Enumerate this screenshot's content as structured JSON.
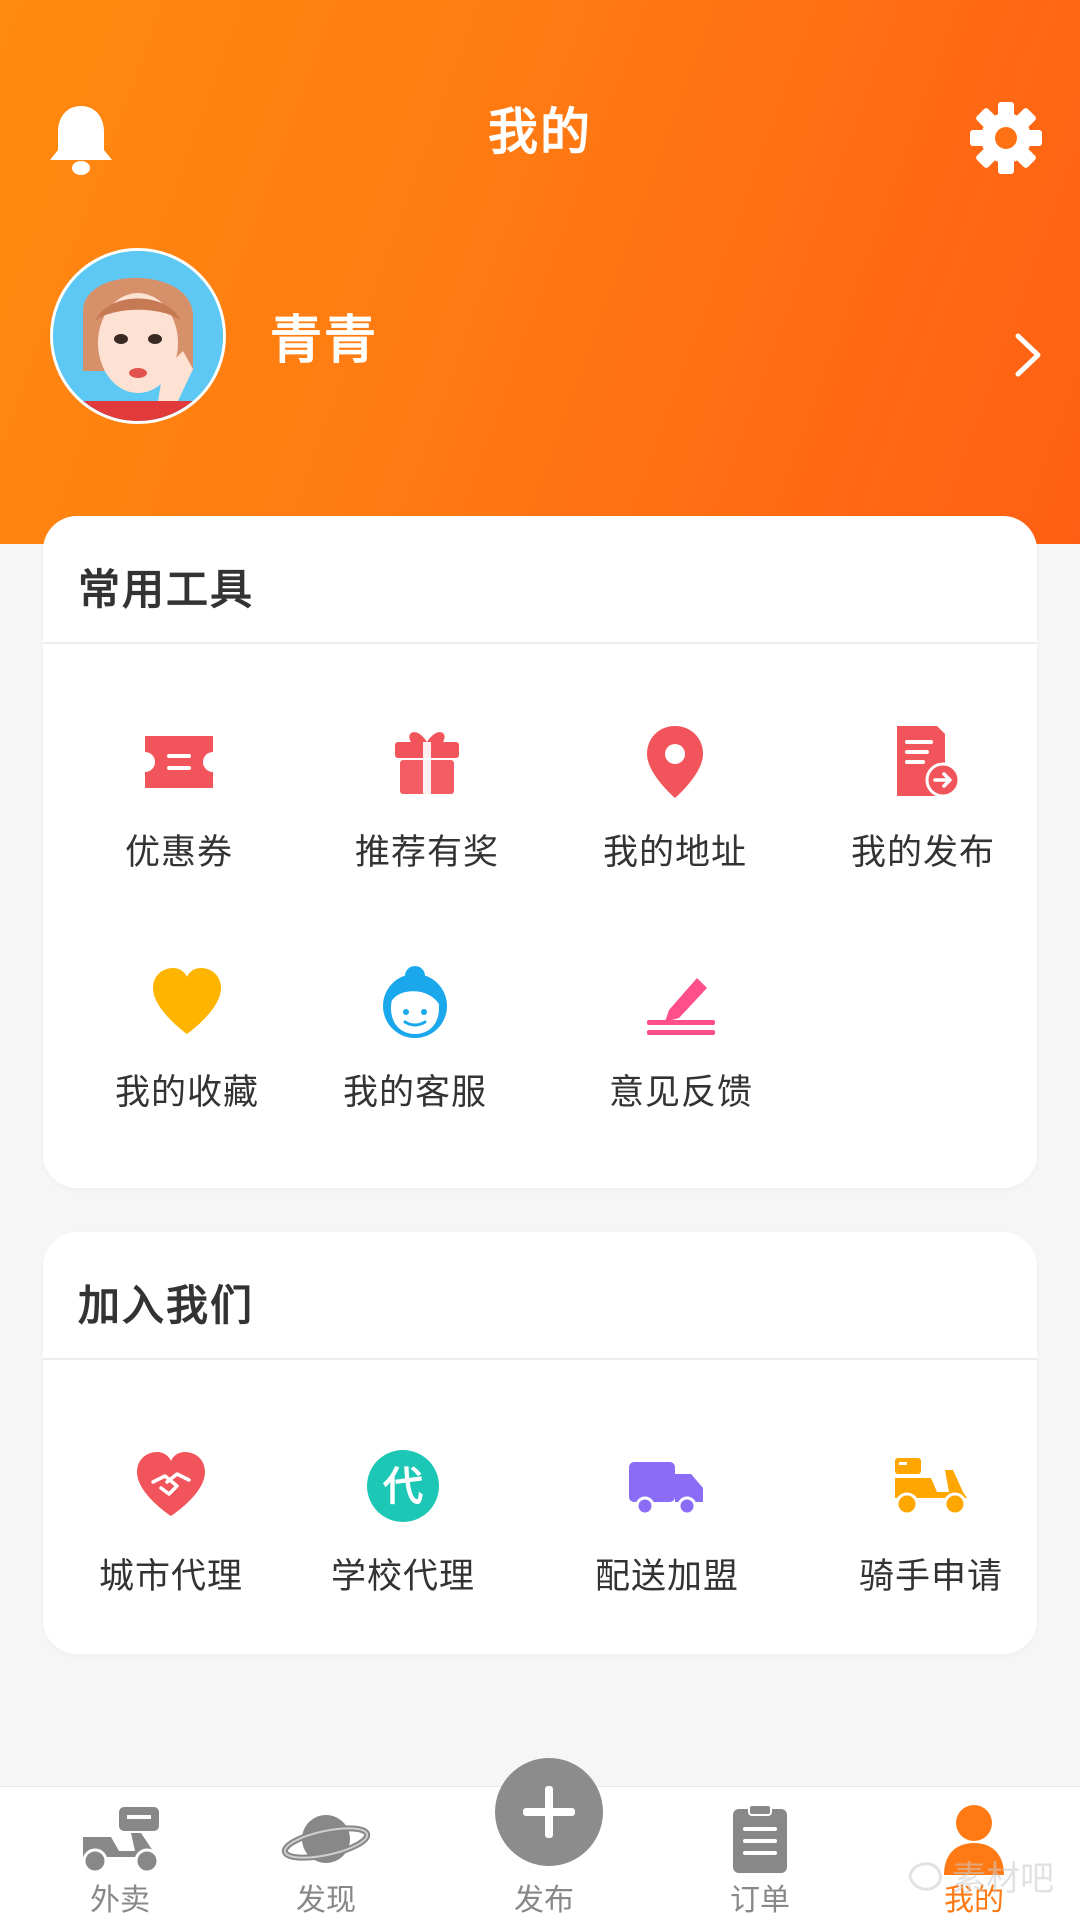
{
  "header": {
    "title": "我的",
    "username": "青青"
  },
  "tools": {
    "title": "常用工具",
    "items": [
      {
        "label": "优惠券",
        "icon": "coupon-icon"
      },
      {
        "label": "推荐有奖",
        "icon": "gift-icon"
      },
      {
        "label": "我的地址",
        "icon": "location-pin-icon"
      },
      {
        "label": "我的发布",
        "icon": "document-share-icon"
      },
      {
        "label": "我的收藏",
        "icon": "heart-icon"
      },
      {
        "label": "我的客服",
        "icon": "customer-service-icon"
      },
      {
        "label": "意见反馈",
        "icon": "pen-icon"
      }
    ]
  },
  "join": {
    "title": "加入我们",
    "items": [
      {
        "label": "城市代理",
        "icon": "handshake-heart-icon"
      },
      {
        "label": "学校代理",
        "icon": "agent-badge-icon",
        "badge": "代"
      },
      {
        "label": "配送加盟",
        "icon": "delivery-truck-icon"
      },
      {
        "label": "骑手申请",
        "icon": "scooter-icon"
      }
    ]
  },
  "tabbar": {
    "tabs": [
      {
        "label": "外卖",
        "icon": "scooter-tab-icon"
      },
      {
        "label": "发现",
        "icon": "planet-icon"
      },
      {
        "label": "发布",
        "icon": "plus-icon"
      },
      {
        "label": "订单",
        "icon": "clipboard-icon"
      },
      {
        "label": "我的",
        "icon": "user-icon",
        "active": true
      }
    ]
  },
  "colors": {
    "accent": "#ff7a14",
    "header_start": "#ff8a10",
    "header_end": "#ff5f14",
    "coupon": "#f2545b",
    "heart": "#ffb400",
    "service": "#1aa7ec",
    "feedback": "#ff4f8b",
    "agent": "#1cc7b5",
    "truck": "#8a6cf6",
    "scooter": "#ffa600",
    "tab_inactive": "#888888"
  },
  "watermark": "素材吧"
}
